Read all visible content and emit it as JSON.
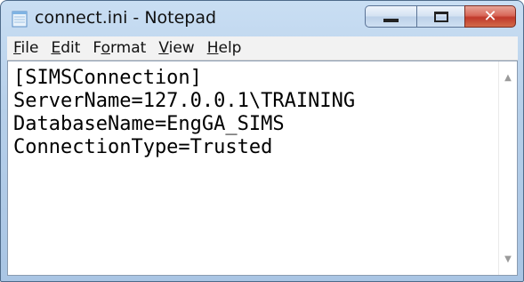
{
  "window": {
    "title": "connect.ini - Notepad",
    "icon": "notepad-icon"
  },
  "caption_buttons": {
    "minimize": "minimize-icon",
    "maximize": "maximize-icon",
    "close": "close-icon",
    "close_glyph": "✕"
  },
  "menu": {
    "items": [
      {
        "underline": "F",
        "rest": "ile"
      },
      {
        "underline": "E",
        "rest": "dit"
      },
      {
        "pre": "F",
        "underline": "o",
        "rest": "rmat"
      },
      {
        "underline": "V",
        "rest": "iew"
      },
      {
        "underline": "H",
        "rest": "elp"
      }
    ]
  },
  "editor": {
    "lines": [
      "[SIMSConnection]",
      "ServerName=127.0.0.1\\TRAINING",
      "DatabaseName=EngGA_SIMS",
      "ConnectionType=Trusted"
    ]
  },
  "scrollbar": {
    "up_glyph": "▲",
    "down_glyph": "▼"
  }
}
